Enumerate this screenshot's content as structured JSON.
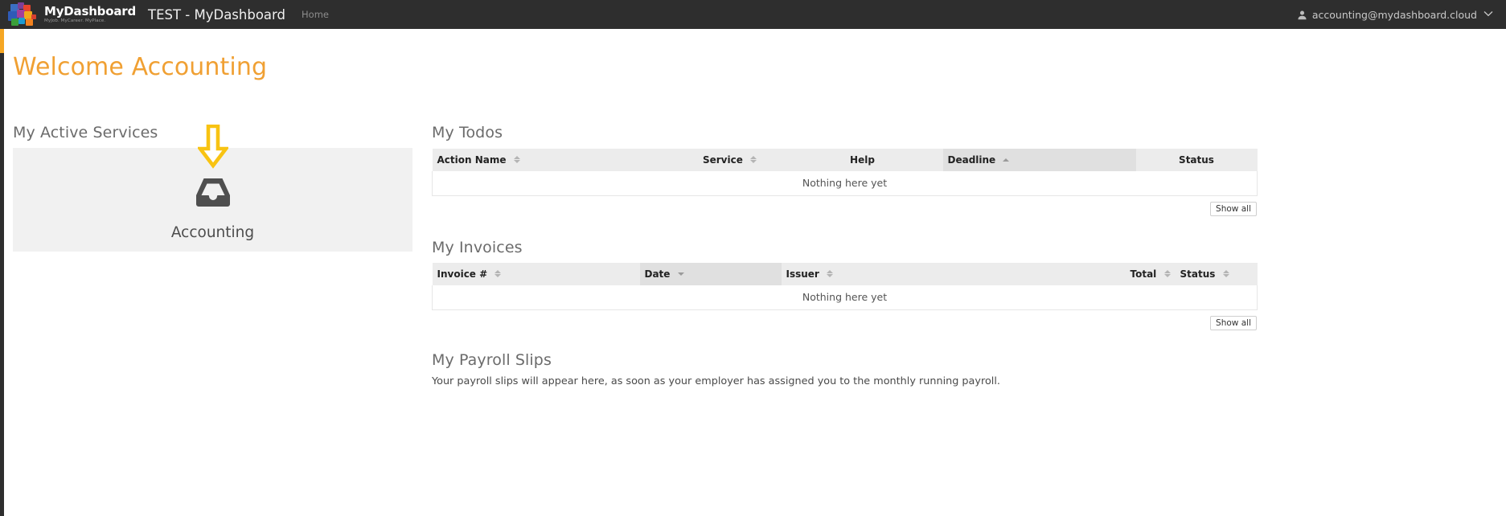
{
  "navbar": {
    "logo_icon": "mosaic-squares-logo",
    "brand_name": "MyDashboard",
    "brand_tagline": "MyJob. MyCareer. MyPlace.",
    "site_title": "TEST - MyDashboard",
    "home_link": "Home",
    "user_icon": "user-icon",
    "user_email": "accounting@mydashboard.cloud",
    "caret_icon": "chevron-down-icon",
    "bg_color": "#2e2e2e"
  },
  "rail": {
    "accent_color": "#f5a623",
    "bar_color": "#2e2e2e"
  },
  "page": {
    "welcome_title": "Welcome Accounting",
    "welcome_color": "#f0a033"
  },
  "active_services": {
    "heading": "My Active Services",
    "arrow_icon": "arrow-down-icon",
    "arrow_color": "#f8c312",
    "cards": [
      {
        "icon": "inbox-icon",
        "label": "Accounting"
      }
    ]
  },
  "todos": {
    "heading": "My Todos",
    "columns": [
      {
        "label": "Action Name",
        "align": "left",
        "sort": "both",
        "active": false
      },
      {
        "label": "Service",
        "align": "center",
        "sort": "both",
        "active": false
      },
      {
        "label": "Help",
        "align": "center",
        "sort": "none",
        "active": false
      },
      {
        "label": "Deadline",
        "align": "left",
        "sort": "asc",
        "active": true
      },
      {
        "label": "Status",
        "align": "center",
        "sort": "none",
        "active": false
      }
    ],
    "empty_text": "Nothing here yet",
    "show_all_label": "Show all"
  },
  "invoices": {
    "heading": "My Invoices",
    "columns": [
      {
        "label": "Invoice #",
        "align": "left",
        "sort": "both",
        "active": false
      },
      {
        "label": "Date",
        "align": "left",
        "sort": "desc",
        "active": true
      },
      {
        "label": "Issuer",
        "align": "left",
        "sort": "both",
        "active": false
      },
      {
        "label": "Total",
        "align": "right",
        "sort": "both",
        "active": false
      },
      {
        "label": "Status",
        "align": "left",
        "sort": "both",
        "active": false
      }
    ],
    "empty_text": "Nothing here yet",
    "show_all_label": "Show all"
  },
  "payroll": {
    "heading": "My Payroll Slips",
    "text": "Your payroll slips will appear here, as soon as your employer has assigned you to the monthly running payroll."
  }
}
